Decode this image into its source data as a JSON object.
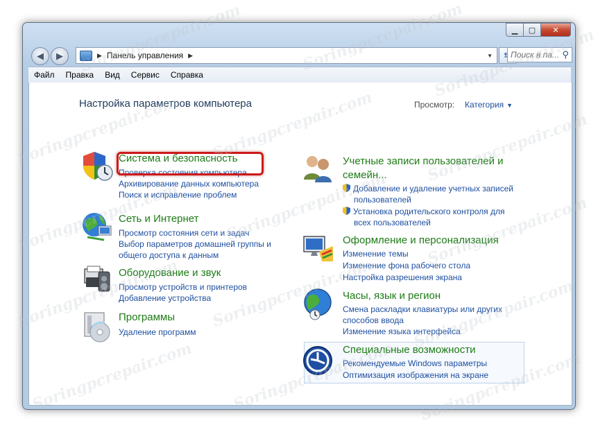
{
  "window": {
    "caption_buttons": {
      "minimize_icon": "minimize-icon",
      "maximize_icon": "maximize-icon",
      "close_icon": "close-icon"
    }
  },
  "address_bar": {
    "breadcrumb": "Панель управления",
    "search_placeholder": "Поиск в па..."
  },
  "menu": [
    "Файл",
    "Правка",
    "Вид",
    "Сервис",
    "Справка"
  ],
  "page": {
    "title": "Настройка параметров компьютера",
    "view_label": "Просмотр:",
    "view_value": "Категория"
  },
  "categories_left": [
    {
      "title": "Система и безопасность",
      "icon": "shield-clock-icon",
      "links": [
        "Проверка состояния компьютера",
        "Архивирование данных компьютера",
        "Поиск и исправление проблем"
      ]
    },
    {
      "title": "Сеть и Интернет",
      "icon": "globe-network-icon",
      "links": [
        "Просмотр состояния сети и задач",
        "Выбор параметров домашней группы и",
        "общего доступа к данным"
      ]
    },
    {
      "title": "Оборудование и звук",
      "icon": "printer-speaker-icon",
      "links": [
        "Просмотр устройств и принтеров",
        "Добавление устройства"
      ]
    },
    {
      "title": "Программы",
      "icon": "programs-disc-icon",
      "links": [
        "Удаление программ"
      ]
    }
  ],
  "categories_right": [
    {
      "title_line1": "Учетные записи пользователей и",
      "title_line2": "семейн...",
      "icon": "users-icon",
      "links": [
        "Добавление и удаление учетных записей",
        "пользователей",
        "Установка родительского контроля для",
        "всех пользователей"
      ]
    },
    {
      "title": "Оформление и персонализация",
      "icon": "monitor-palette-icon",
      "links": [
        "Изменение темы",
        "Изменение фона рабочего стола",
        "Настройка разрешения экрана"
      ]
    },
    {
      "title": "Часы, язык и регион",
      "icon": "clock-globe-icon",
      "links": [
        "Смена раскладки клавиатуры или других",
        "способов ввода",
        "Изменение языка интерфейса"
      ]
    },
    {
      "title": "Специальные возможности",
      "icon": "accessibility-icon",
      "links": [
        "Рекомендуемые Windows параметры",
        "Оптимизация изображения на экране"
      ]
    }
  ],
  "watermark": "Soringpcrepair.com",
  "colors": {
    "link": "#1e4fa0",
    "category_title": "#1d7b16",
    "highlight": "#cc1a1a"
  }
}
